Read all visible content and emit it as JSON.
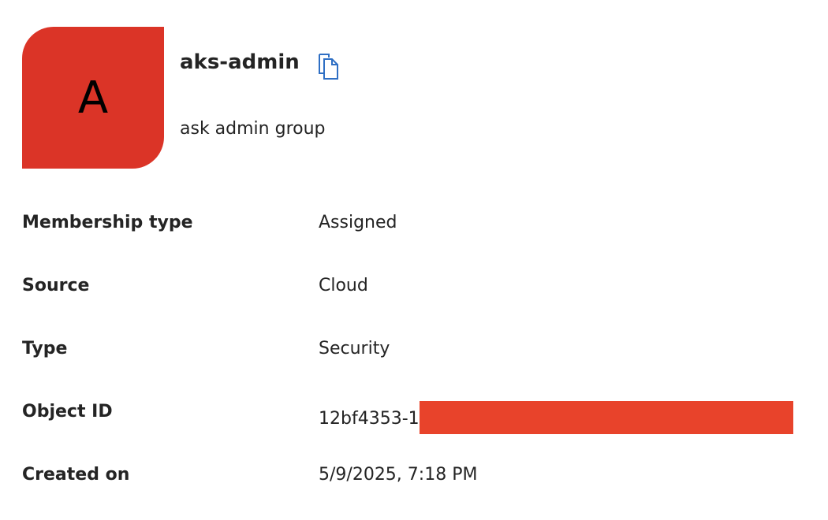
{
  "group": {
    "avatar_letter": "A",
    "avatar_color": "#db3427",
    "name": "aks-admin",
    "description": "ask admin group"
  },
  "icons": {
    "copy": "copy-icon"
  },
  "accent_color": "#2f6fc4",
  "redaction_color": "#e8432b",
  "properties": [
    {
      "label": "Membership type",
      "value": "Assigned"
    },
    {
      "label": "Source",
      "value": "Cloud"
    },
    {
      "label": "Type",
      "value": "Security"
    },
    {
      "label": "Object ID",
      "value": "12bf4353-1"
    },
    {
      "label": "Created on",
      "value": "5/9/2025, 7:18 PM"
    }
  ]
}
